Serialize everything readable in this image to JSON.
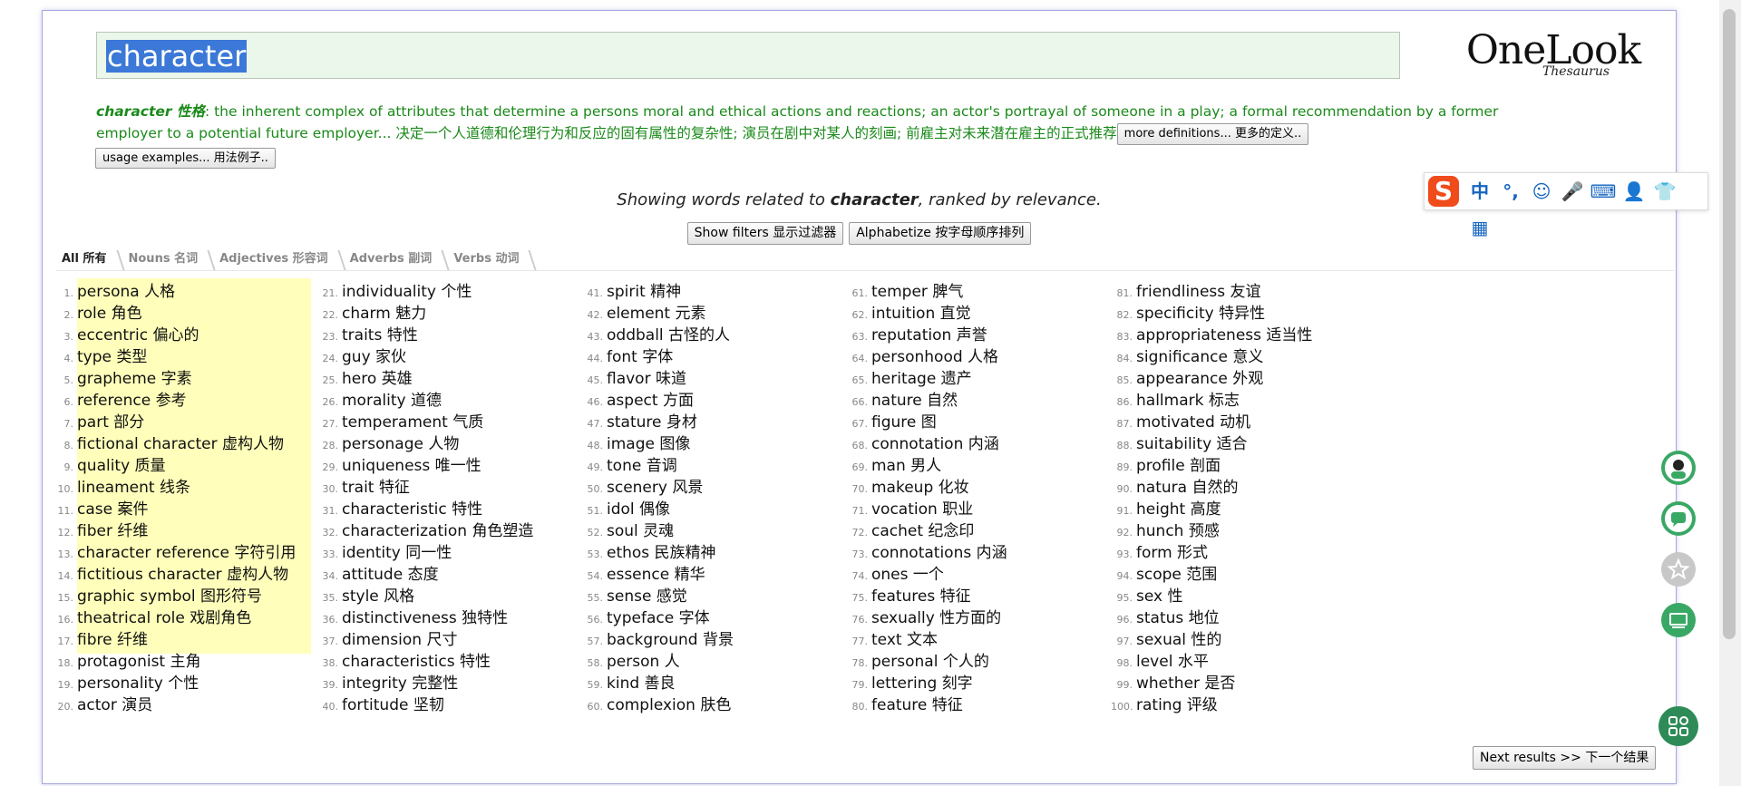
{
  "search": {
    "query": "character"
  },
  "logo": {
    "name": "OneLook",
    "sub": "Thesaurus"
  },
  "definition": {
    "word": "character 性格",
    "text": ": the inherent complex of attributes that determine a persons moral and ethical actions and reactions; an actor's portrayal of someone in a play; a formal recommendation by a former employer to a potential future employer... 决定一个人道德和伦理行为和反应的固有属性的复杂性; 演员在剧中对某人的刻画; 前雇主对未来潜在雇主的正式推荐",
    "more_button": "more definitions... 更多的定义..",
    "usage_button": "usage examples... 用法例子.."
  },
  "showing": {
    "prefix": "Showing words related to ",
    "word": "character",
    "suffix": ", ranked by relevance."
  },
  "filters": {
    "show_filters": "Show filters 显示过滤器",
    "alphabetize": "Alphabetize 按字母顺序排列"
  },
  "tabs": [
    "All 所有",
    "Nouns 名词",
    "Adjectives 形容词",
    "Adverbs 副词",
    "Verbs 动词"
  ],
  "results": [
    "persona 人格",
    "role 角色",
    "eccentric 偏心的",
    "type 类型",
    "grapheme 字素",
    "reference 参考",
    "part 部分",
    "fictional character 虚构人物",
    "quality 质量",
    "lineament 线条",
    "case 案件",
    "fiber 纤维",
    "character reference 字符引用",
    "fictitious character 虚构人物",
    "graphic symbol 图形符号",
    "theatrical role 戏剧角色",
    "fibre 纤维",
    "protagonist 主角",
    "personality 个性",
    "actor 演员",
    "individuality 个性",
    "charm 魅力",
    "traits 特性",
    "guy 家伙",
    "hero 英雄",
    "morality 道德",
    "temperament 气质",
    "personage 人物",
    "uniqueness 唯一性",
    "trait 特征",
    "characteristic 特性",
    "characterization 角色塑造",
    "identity 同一性",
    "attitude 态度",
    "style 风格",
    "distinctiveness 独特性",
    "dimension 尺寸",
    "characteristics 特性",
    "integrity 完整性",
    "fortitude 坚韧",
    "spirit 精神",
    "element 元素",
    "oddball 古怪的人",
    "font 字体",
    "flavor 味道",
    "aspect 方面",
    "stature 身材",
    "image 图像",
    "tone 音调",
    "scenery 风景",
    "idol 偶像",
    "soul 灵魂",
    "ethos 民族精神",
    "essence 精华",
    "sense 感觉",
    "typeface 字体",
    "background 背景",
    "person 人",
    "kind 善良",
    "complexion 肤色",
    "temper 脾气",
    "intuition 直觉",
    "reputation 声誉",
    "personhood 人格",
    "heritage 遗产",
    "nature 自然",
    "figure 图",
    "connotation 内涵",
    "man 男人",
    "makeup 化妆",
    "vocation 职业",
    "cachet 纪念印",
    "connotations 内涵",
    "ones 一个",
    "features 特征",
    "sexually 性方面的",
    "text 文本",
    "personal 个人的",
    "lettering 刻字",
    "feature 特征",
    "friendliness 友谊",
    "specificity 特异性",
    "appropriateness 适当性",
    "significance 意义",
    "appearance 外观",
    "hallmark 标志",
    "motivated 动机",
    "suitability 适合",
    "profile 剖面",
    "natura 自然的",
    "height 高度",
    "hunch 预感",
    "form 形式",
    "scope 范围",
    "sex 性",
    "status 地位",
    "sexual 性的",
    "level 水平",
    "whether 是否",
    "rating 评级"
  ],
  "next_button": "Next results >> 下一个结果",
  "ime": {
    "logo": "S",
    "items": [
      "中",
      "°,",
      "☺",
      "🎤",
      "⌨",
      "👤",
      "👕",
      "▦"
    ]
  },
  "colors": {
    "definition": "#1a8a1a",
    "highlight": "#ffffbb",
    "selection": "#3b78d8",
    "float_green": "#3aa865"
  }
}
